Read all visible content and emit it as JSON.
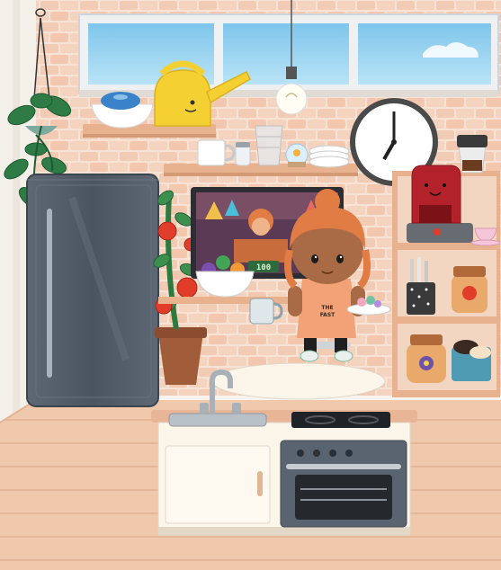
{
  "scene": {
    "name": "Kitchen",
    "colors": {
      "wall_brick": "#f2cdb8",
      "wall_plain": "#f7f3ee",
      "floor": "#f0c9ad",
      "fridge": "#4f5a66",
      "counter_top": "#e8b597",
      "cabinet_front": "#fbf5ea",
      "oven": "#5a6470",
      "shelf_wood": "#e9b28f",
      "character_hair": "#e07c44",
      "character_skin": "#a86b45",
      "kettle": "#f5d033",
      "coffee_maker": "#b3212a"
    }
  },
  "tv": {
    "score_text": "100"
  },
  "character": {
    "shirt_text_line1": "THE",
    "shirt_text_line2": "FAST"
  },
  "clock": {
    "hour_hand_hour": 7,
    "minute_hand_minute": 0
  },
  "items": {
    "window_panes": 3,
    "tomatoes_on_plant": 4,
    "pending_icons": [
      "pendant-lamp-icon",
      "clock-icon",
      "coffee-maker-icon",
      "kettle-icon",
      "fridge-icon",
      "oven-icon",
      "sink-faucet-icon",
      "tv-icon",
      "plant-icon",
      "fruit-bowl-icon",
      "mug-icon",
      "jar-icon"
    ]
  }
}
